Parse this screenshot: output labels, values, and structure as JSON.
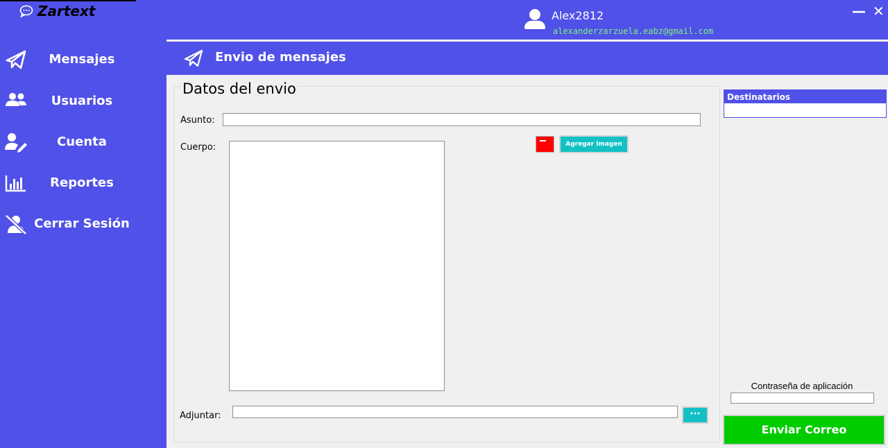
{
  "app": {
    "title": "Zartext",
    "user_name": "Alex2812",
    "user_email": "alexanderzarzuela.eabz@gmail.com",
    "minimize_symbol": "—",
    "close_symbol": "✕"
  },
  "sidebar": {
    "items": [
      {
        "label": "Mensajes",
        "icon": "paper-plane-icon"
      },
      {
        "label": "Usuarios",
        "icon": "users-icon"
      },
      {
        "label": "Cuenta",
        "icon": "user-edit-icon"
      },
      {
        "label": "Reportes",
        "icon": "bar-chart-icon"
      },
      {
        "label": "Cerrar Sesión",
        "icon": "user-slash-icon"
      }
    ]
  },
  "header": {
    "title": "Envio de mensajes"
  },
  "form": {
    "group_title": "Datos del envio",
    "subject_label": "Asunto:",
    "subject_value": "",
    "body_label": "Cuerpo:",
    "body_value": "",
    "add_image_label": "Agregar imagen",
    "attach_label": "Adjuntar:",
    "attach_value": "",
    "browse_label": "•••"
  },
  "recipients": {
    "header": "Destinatarios"
  },
  "password": {
    "label": "Contraseña de aplicación",
    "value": ""
  },
  "send_button": {
    "label": "Enviar Correo"
  },
  "colors": {
    "accent": "#5051e8",
    "send": "#00cc00",
    "teal": "#13c1c4",
    "email": "#7ef07e"
  }
}
